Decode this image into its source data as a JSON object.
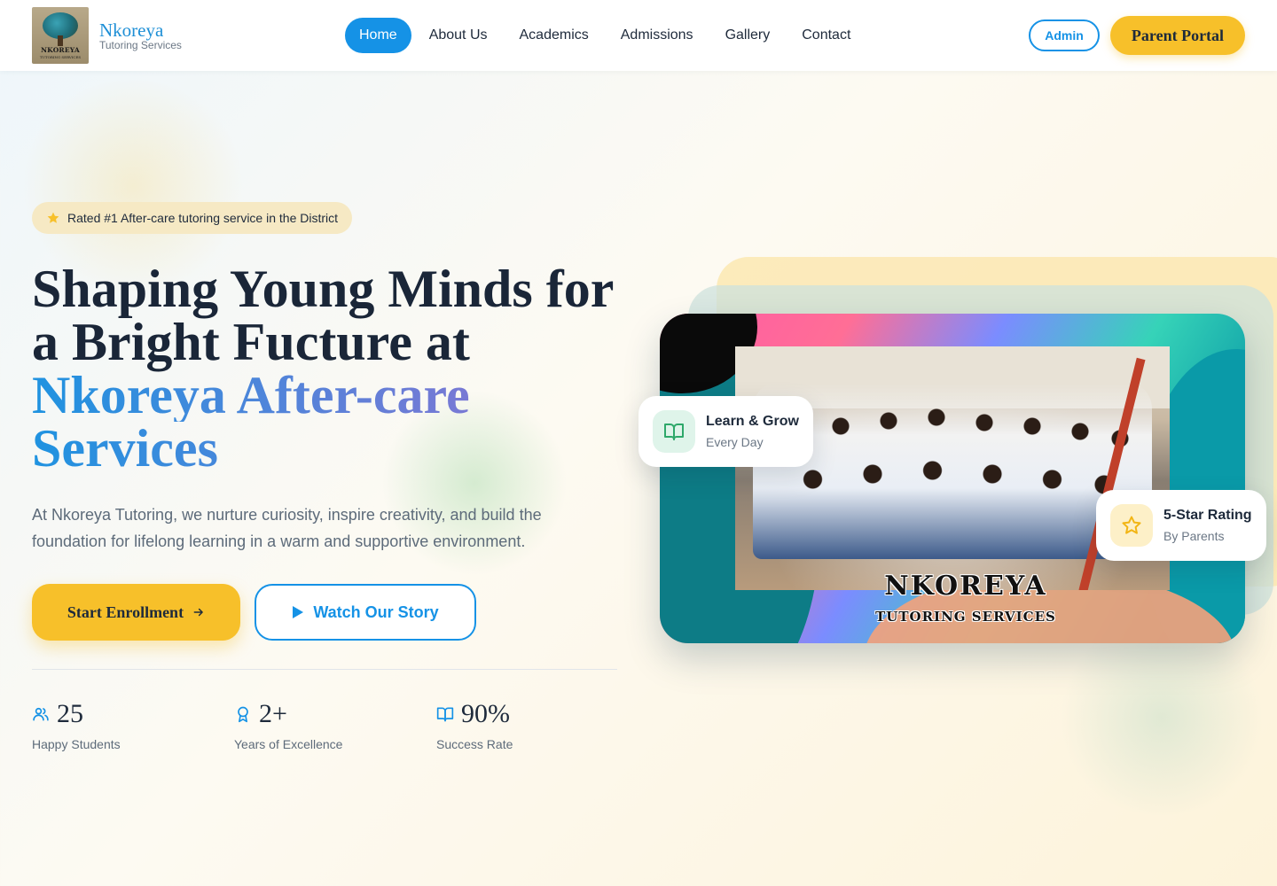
{
  "brand": {
    "logo_text": "NKOREYA",
    "logo_subtext": "TUTORING SERVICES",
    "name": "Nkoreya",
    "tagline": "Tutoring Services"
  },
  "nav": {
    "items": [
      "Home",
      "About Us",
      "Academics",
      "Admissions",
      "Gallery",
      "Contact"
    ],
    "active": "Home"
  },
  "header_actions": {
    "admin_label": "Admin",
    "portal_label": "Parent Portal"
  },
  "hero": {
    "badge": "Rated #1 After-care tutoring service in the District",
    "headline_line1": "Shaping Young Minds for",
    "headline_line2": "a Bright Fucture at",
    "headline_accent_line1": "Nkoreya After-care",
    "headline_accent_line2": "Services",
    "intro_line1": "At Nkoreya Tutoring, we nurture curiosity, inspire creativity, and build the",
    "intro_line2": "foundation for lifelong learning in a warm and supportive environment.",
    "enroll_label": "Start Enrollment",
    "story_label": "Watch Our Story"
  },
  "stats": [
    {
      "icon": "users-icon",
      "value": "25",
      "label": "Happy Students"
    },
    {
      "icon": "award-icon",
      "value": "2+",
      "label": "Years of Excellence"
    },
    {
      "icon": "book-icon",
      "value": "90%",
      "label": "Success Rate"
    }
  ],
  "photo": {
    "title": "NKOREYA",
    "subtitle": "TUTORING SERVICES"
  },
  "floating_cards": {
    "learn": {
      "title": "Learn & Grow",
      "subtitle": "Every Day",
      "icon": "book-open-icon"
    },
    "rating": {
      "title": "5-Star Rating",
      "subtitle": "By Parents",
      "icon": "star-outline-icon"
    }
  },
  "colors": {
    "primary_blue": "#1592e6",
    "accent_yellow": "#f7c02a",
    "heading_dark": "#1a2638",
    "gradient_end_purple": "#9a6fd0"
  }
}
